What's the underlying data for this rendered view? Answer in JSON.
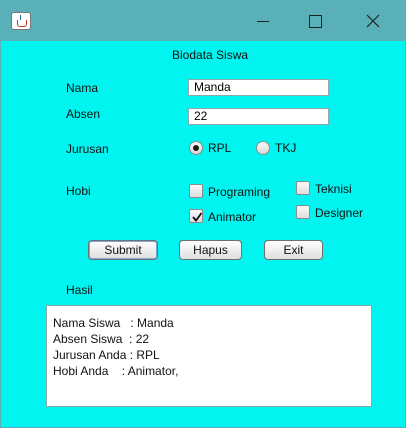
{
  "window": {
    "controls": {
      "minimize_icon": "minimize-icon",
      "maximize_icon": "maximize-icon",
      "close_icon": "close-icon"
    }
  },
  "form": {
    "title": "Biodata Siswa",
    "nama": {
      "label": "Nama",
      "value": "Manda"
    },
    "absen": {
      "label": "Absen",
      "value": "22"
    },
    "jurusan": {
      "label": "Jurusan",
      "options": [
        {
          "label": "RPL",
          "selected": true
        },
        {
          "label": "TKJ",
          "selected": false
        }
      ]
    },
    "hobi": {
      "label": "Hobi",
      "options": [
        {
          "label": "Programing",
          "checked": false
        },
        {
          "label": "Animator",
          "checked": true
        },
        {
          "label": "Teknisi",
          "checked": false
        },
        {
          "label": "Designer",
          "checked": false
        }
      ]
    },
    "buttons": {
      "submit": "Submit",
      "hapus": "Hapus",
      "exit": "Exit"
    },
    "hasil": {
      "label": "Hasil",
      "lines": [
        "Nama Siswa   : Manda",
        "Absen Siswa  : 22",
        "Jurusan Anda : RPL",
        "Hobi Anda    : Animator,"
      ]
    }
  },
  "colors": {
    "background": "#00f5f0",
    "titlebar": "#5ab0b8"
  }
}
